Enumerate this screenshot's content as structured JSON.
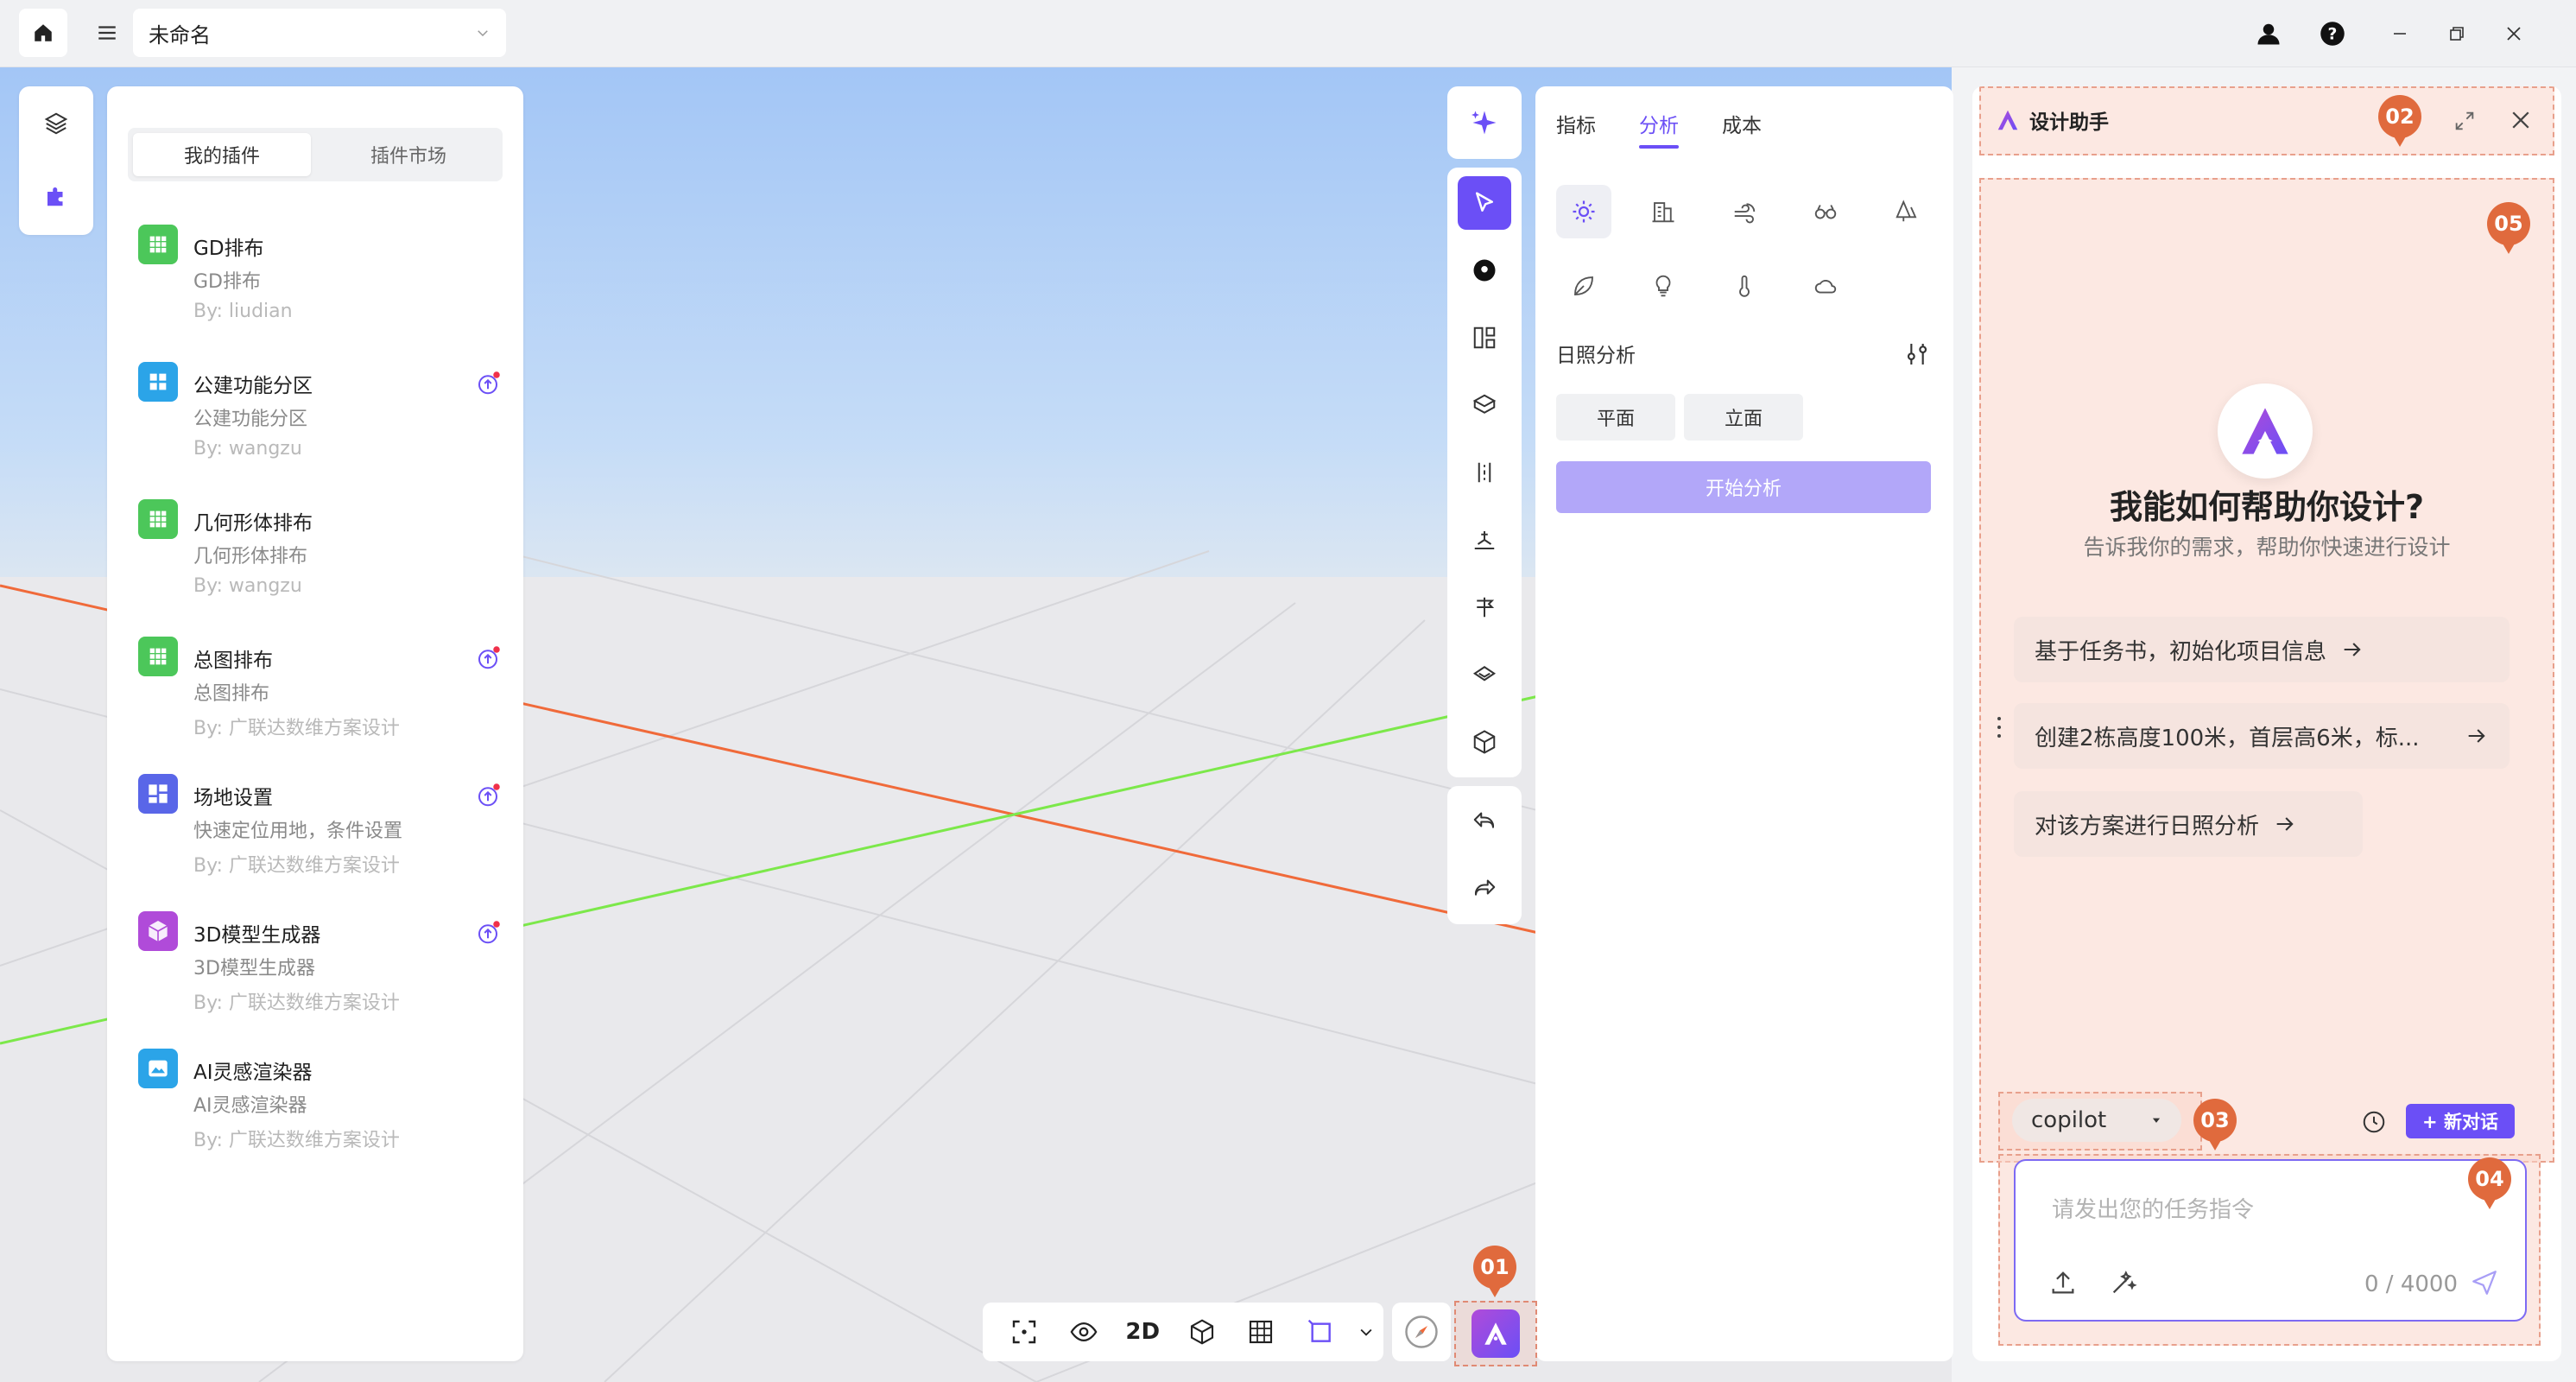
{
  "titlebar": {
    "project_name": "未命名"
  },
  "plugins_panel": {
    "tabs": [
      {
        "label": "我的插件",
        "active": true
      },
      {
        "label": "插件市场",
        "active": false
      }
    ],
    "items": [
      {
        "name": "GD排布",
        "desc": "GD排布",
        "author": "By: liudian",
        "icon_color": "#4cc75a",
        "update": false
      },
      {
        "name": "公建功能分区",
        "desc": "公建功能分区",
        "author": "By: wangzu",
        "icon_color": "#2ba4e8",
        "update": true
      },
      {
        "name": "几何形体排布",
        "desc": "几何形体排布",
        "author": "By: wangzu",
        "icon_color": "#4cc75a",
        "update": false
      },
      {
        "name": "总图排布",
        "desc": "总图排布",
        "author": "By: 广联达数维方案设计",
        "icon_color": "#4cc75a",
        "update": true
      },
      {
        "name": "场地设置",
        "desc": "快速定位用地，条件设置",
        "author": "By: 广联达数维方案设计",
        "icon_color": "#5966e8",
        "update": true
      },
      {
        "name": "3D模型生成器",
        "desc": "3D模型生成器",
        "author": "By: 广联达数维方案设计",
        "icon_color": "#b04bd9",
        "update": true
      },
      {
        "name": "AI灵感渲染器",
        "desc": "AI灵感渲染器",
        "author": "By: 广联达数维方案设计",
        "icon_color": "#2ba4e8",
        "update": false
      }
    ]
  },
  "analysis_panel": {
    "tabs": [
      {
        "label": "指标",
        "active": false
      },
      {
        "label": "分析",
        "active": true
      },
      {
        "label": "成本",
        "active": false
      }
    ],
    "section_title": "日照分析",
    "buttons": [
      "平面",
      "立面"
    ],
    "start_label": "开始分析"
  },
  "bottom_toolbar": {
    "mode_2d": "2D"
  },
  "badges": [
    "01",
    "02",
    "03",
    "04",
    "05"
  ],
  "assistant": {
    "title": "设计助手",
    "greeting": "我能如何帮助你设计?",
    "subtitle": "告诉我你的需求，帮助你快速进行设计",
    "suggestions": [
      "基于任务书，初始化项目信息",
      "创建2栋高度100米，首层高6米，标...",
      "对该方案进行日照分析"
    ],
    "model": "copilot",
    "new_chat_label": "+ 新对话",
    "input_placeholder": "请发出您的任务指令",
    "char_count": "0 / 4000"
  },
  "colors": {
    "accent": "#6b4ff6",
    "badge": "#e06a3d",
    "axis_x": "#f06a3a",
    "axis_y": "#7ce84a"
  }
}
